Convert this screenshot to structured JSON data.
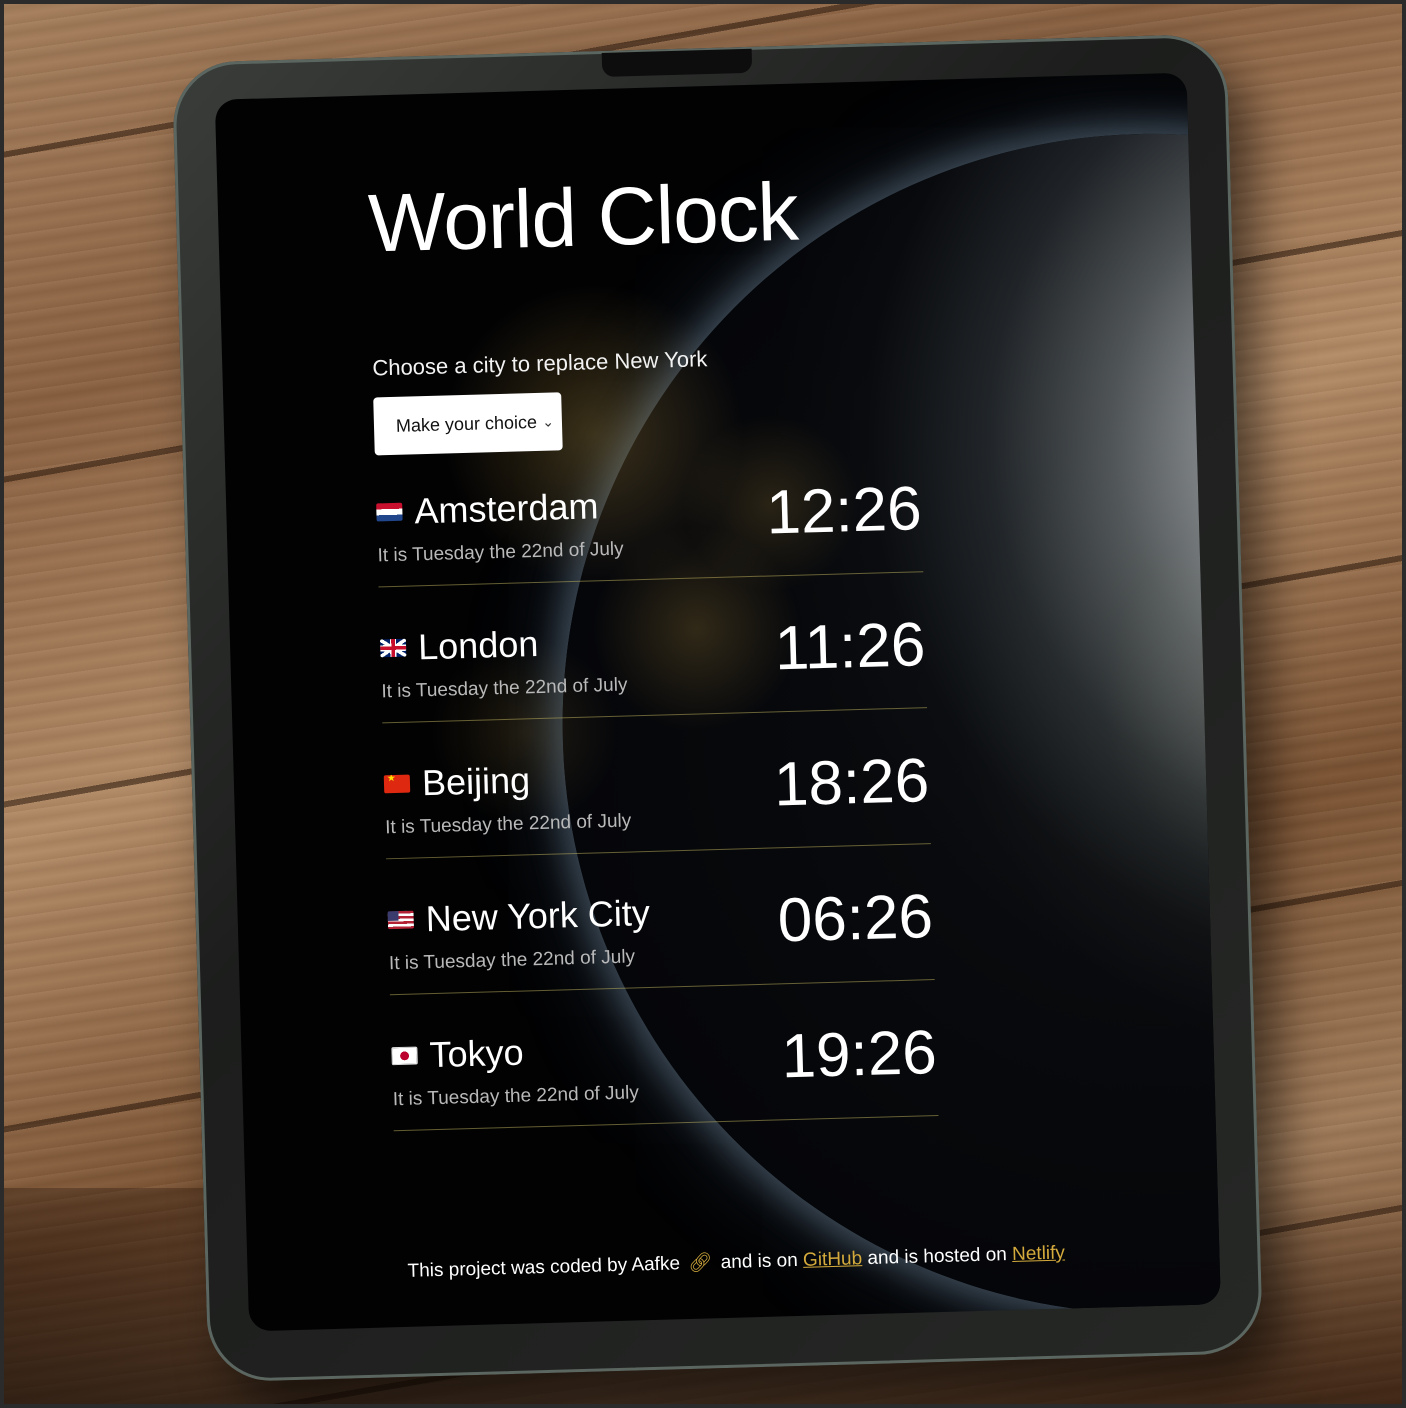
{
  "app": {
    "title": "World Clock"
  },
  "selector": {
    "label": "Choose a city to replace New York",
    "selected_value": "Make your choice"
  },
  "cities": [
    {
      "name": "Amsterdam",
      "flag": "flag-netherlands-icon",
      "date": "It is Tuesday the 22nd of July",
      "time": "12:26"
    },
    {
      "name": "London",
      "flag": "flag-uk-icon",
      "date": "It is Tuesday the 22nd of July",
      "time": "11:26"
    },
    {
      "name": "Beijing",
      "flag": "flag-china-icon",
      "date": "It is Tuesday the 22nd of July",
      "time": "18:26"
    },
    {
      "name": "New York City",
      "flag": "flag-usa-icon",
      "date": "It is Tuesday the 22nd of July",
      "time": "06:26"
    },
    {
      "name": "Tokyo",
      "flag": "flag-japan-icon",
      "date": "It is Tuesday the 22nd of July",
      "time": "19:26"
    }
  ],
  "footer": {
    "prefix": "This project was coded by Aafke",
    "middle": "and is on",
    "github_label": "GitHub",
    "hosted": "and is hosted on",
    "netlify_label": "Netlify"
  },
  "colors": {
    "accent": "#d4aa3c",
    "background": "#020203",
    "text": "#ffffff",
    "divider": "#b4aa5a"
  }
}
